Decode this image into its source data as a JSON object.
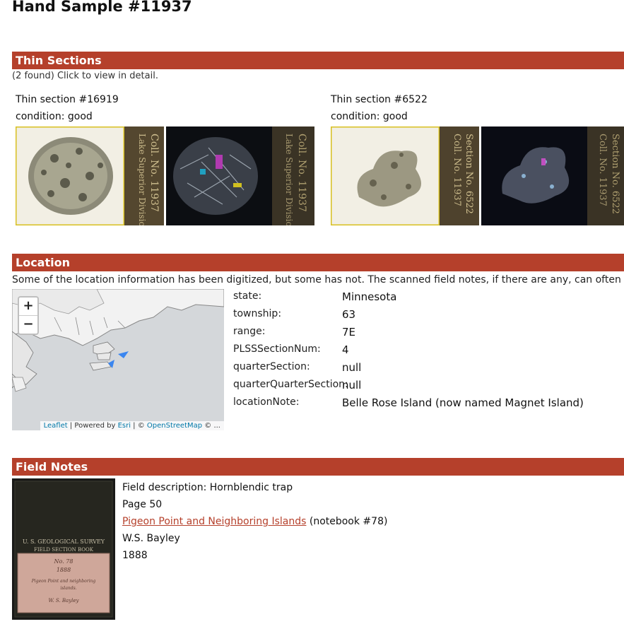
{
  "page": {
    "title": "Hand Sample #11937"
  },
  "thin_sections": {
    "heading": "Thin Sections",
    "summary": "(2 found) Click to view in detail.",
    "items": [
      {
        "title": "Thin section #16919",
        "condition": "condition: good"
      },
      {
        "title": "Thin section #6522",
        "condition": "condition: good"
      }
    ]
  },
  "location": {
    "heading": "Location",
    "intro": "Some of the location information has been digitized, but some has not. The scanned field notes, if there are any, can often provide more",
    "map": {
      "zoom_in": "+",
      "zoom_out": "−",
      "attribution_leaflet": "Leaflet",
      "attribution_powered": " | Powered by ",
      "attribution_esri": "Esri",
      "attribution_sep": " | © ",
      "attribution_osm": "OpenStreetMap",
      "attribution_tail": " © ..."
    },
    "fields": [
      {
        "key": "state:",
        "value": "Minnesota"
      },
      {
        "key": "township:",
        "value": "63"
      },
      {
        "key": "range:",
        "value": "7E"
      },
      {
        "key": "PLSSSectionNum:",
        "value": "4"
      },
      {
        "key": "quarterSection:",
        "value": "null"
      },
      {
        "key": "quarterQuarterSection:",
        "value": "null"
      },
      {
        "key": "locationNote:",
        "value": "Belle Rose Island (now named Magnet Island)"
      }
    ]
  },
  "field_notes": {
    "heading": "Field Notes",
    "description": "Field description: Hornblendic trap",
    "page": "Page 50",
    "notebook_link": "Pigeon Point and Neighboring Islands",
    "notebook_number": " (notebook #78)",
    "author": "W.S. Bayley",
    "year": "1888",
    "cover_text": {
      "line1": "U. S. GEOLOGICAL SURVEY",
      "line2": "FIELD SECTION BOOK",
      "line3": "No. 78",
      "line4": "1888",
      "line5": "Pigeon Point and neighboring",
      "line6": "islands.",
      "line7": "W. S. Bayley"
    }
  },
  "colors": {
    "accent": "#b5402b",
    "link": "#b5402b",
    "map_water": "#d4d7da"
  }
}
